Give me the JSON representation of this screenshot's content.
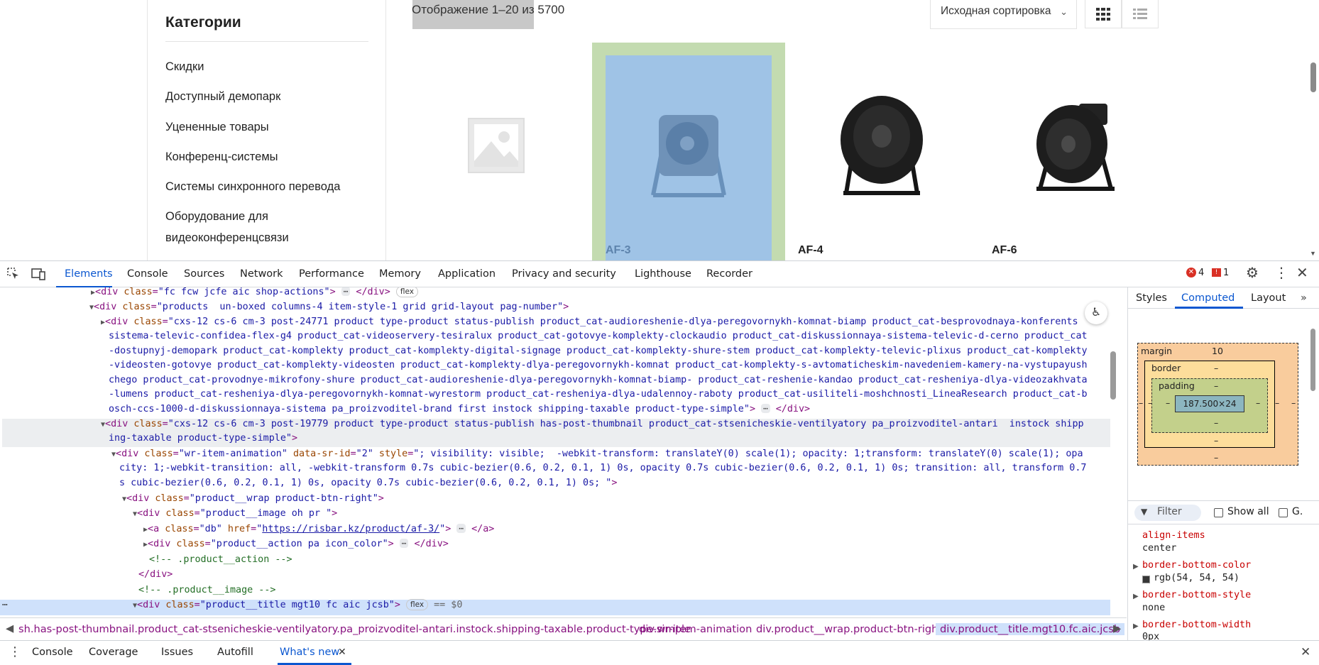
{
  "page": {
    "categories_title": "Категории",
    "categories": [
      "Скидки",
      "Доступный демопарк",
      "Уцененные товары",
      "Конференц-системы",
      "Системы синхронного перевода",
      "Оборудование для",
      "видеоконференцсвязи"
    ],
    "result_count": "Отображение 1–20 из 5700",
    "sort_label": "Исходная сортировка",
    "products": [
      "AF-3",
      "AF-4",
      "AF-6"
    ]
  },
  "devtools": {
    "tabs": [
      "Elements",
      "Console",
      "Sources",
      "Network",
      "Performance",
      "Memory",
      "Application",
      "Privacy and security",
      "Lighthouse",
      "Recorder"
    ],
    "errors": "4",
    "warnings": "1",
    "dom": {
      "l1_cls": "fc fcw jcfe aic shop-actions",
      "l1_pill": "flex",
      "l2_cls": "products  un-boxed columns-4 item-style-1 grid grid-layout pag-number",
      "l3a": "cxs-12 cs-6 cm-3 post-24771 product type-product status-publish product_cat-audioreshenie-dlya-peregovornykh-komnat-biamp product_cat-besprovodnaya-konferents",
      "l3b": "sistema-televic-confidea-flex-g4 product_cat-videoservery-tesiralux product_cat-gotovye-komplekty-clockaudio product_cat-diskussionnaya-sistema-televic-d-cerno product_cat",
      "l3c": "-dostupnyj-demopark product_cat-komplekty product_cat-komplekty-digital-signage product_cat-komplekty-shure-stem product_cat-komplekty-televic-plixus product_cat-komplekty",
      "l3d": "-videosten-gotovye product_cat-komplekty-videosten product_cat-komplekty-dlya-peregovornykh-komnat product_cat-komplekty-s-avtomaticheskim-navedeniem-kamery-na-vystupayush",
      "l3e": "chego product_cat-provodnye-mikrofony-shure product_cat-audioreshenie-dlya-peregovornykh-komnat-biamp- product_cat-reshenie-kandao product_cat-resheniya-dlya-videozakhvata",
      "l3f": "-lumens product_cat-resheniya-dlya-peregovornykh-komnat-wyrestorm product_cat-resheniya-dlya-udalennoy-raboty product_cat-usiliteli-moshchnosti_LineaResearch product_cat-b",
      "l3g": "osch-ccs-1000-d-diskussionnaya-sistema pa_proizvoditel-brand first instock shipping-taxable product-type-simple",
      "l4a": "cxs-12 cs-6 cm-3 post-19779 product type-product status-publish has-post-thumbnail product_cat-stsenicheskie-ventilyatory pa_proizvoditel-antari  instock shipp",
      "l4b": "ing-taxable product-type-simple",
      "l5_cls": "wr-item-animation",
      "l5_attr": "data-sr-id",
      "l5_id": "2",
      "l5_style_a": "; visibility: visible;  -webkit-transform: translateY(0) scale(1); opacity: 1;transform: translateY(0) scale(1); opa",
      "l5_style_b": "city: 1;-webkit-transition: all, -webkit-transform 0.7s cubic-bezier(0.6, 0.2, 0.1, 1) 0s, opacity 0.7s cubic-bezier(0.6, 0.2, 0.1, 1) 0s; transition: all, transform 0.7",
      "l5_style_c": "s cubic-bezier(0.6, 0.2, 0.1, 1) 0s, opacity 0.7s cubic-bezier(0.6, 0.2, 0.1, 1) 0s; ",
      "l6_cls": "product__wrap product-btn-right",
      "l7_cls": "product__image oh pr ",
      "l8_cls": "db",
      "l8_href": "https://risbar.kz/product/af-3/",
      "l9_cls": "product__action pa icon_color",
      "l10_comment": "<!-- .product__action -->",
      "l12_comment": "<!-- .product__image -->",
      "l13_cls": "product__title mgt10 fc aic jcsb",
      "l13_pill": "flex",
      "l13_eq": "== $0"
    },
    "breadcrumbs": [
      "sh.has-post-thumbnail.product_cat-stsenicheskie-ventilyatory.pa_proizvoditel-antari.instock.shipping-taxable.product-type-simple",
      "div.wr-item-animation",
      "div.product__wrap.product-btn-right",
      "div.product__title.mgt10.fc.aic.jcsb"
    ],
    "right_tabs": [
      "Styles",
      "Computed",
      "Layout"
    ],
    "box_model": {
      "margin_label": "margin",
      "margin_top": "10",
      "border_label": "border",
      "padding_label": "padding",
      "content": "187.500×24",
      "dash": "–"
    },
    "filter_placeholder": "Filter",
    "show_all": "Show all",
    "group": "G.",
    "computed": [
      {
        "prop": "align-items",
        "value": "center"
      },
      {
        "prop": "border-bottom-color",
        "value": "rgb(54, 54, 54)"
      },
      {
        "prop": "border-bottom-style",
        "value": "none"
      },
      {
        "prop": "border-bottom-width",
        "value": "0px"
      }
    ],
    "drawer_tabs": [
      "Console",
      "Coverage",
      "Issues",
      "Autofill",
      "What's new"
    ]
  }
}
